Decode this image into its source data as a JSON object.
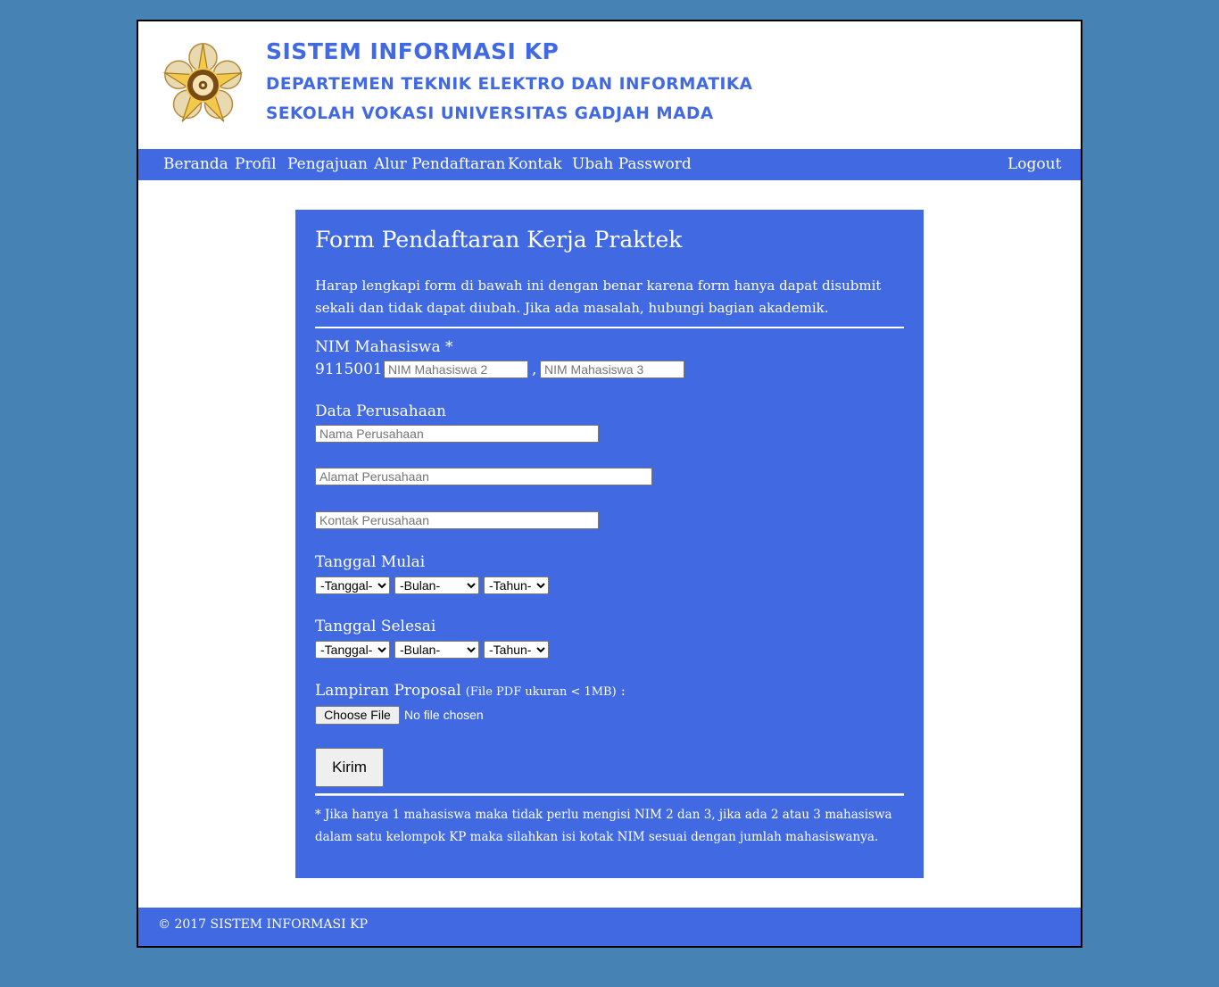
{
  "header": {
    "title": "SISTEM INFORMASI KP",
    "line2": "DEPARTEMEN TEKNIK ELEKTRO DAN INFORMATIKA",
    "line3": "SEKOLAH VOKASI UNIVERSITAS GADJAH MADA",
    "logo_icon": "university-seal-icon"
  },
  "nav": {
    "items": [
      "Beranda",
      "Profil",
      "Pengajuan",
      "Alur Pendaftaran",
      "Kontak",
      "Ubah Password"
    ],
    "logout": "Logout"
  },
  "form": {
    "title": "Form Pendaftaran Kerja Praktek",
    "intro": "Harap lengkapi form di bawah ini dengan benar karena form hanya dapat disubmit sekali dan tidak dapat diubah. Jika ada masalah, hubungi bagian akademik.",
    "nim_label": "NIM Mahasiswa *",
    "nim1": "9115001 ,",
    "nim_sep": ",",
    "nim2_placeholder": "NIM Mahasiswa 2",
    "nim3_placeholder": "NIM Mahasiswa 3",
    "company_label": "Data Perusahaan",
    "company_name_placeholder": "Nama Perusahaan",
    "company_address_placeholder": "Alamat Perusahaan",
    "company_contact_placeholder": "Kontak Perusahaan",
    "start_label": "Tanggal Mulai",
    "end_label": "Tanggal Selesai",
    "day_select": "-Tanggal-",
    "month_select": "-Bulan-",
    "year_select": "-Tahun-",
    "attachment_label": "Lampiran Proposal",
    "attachment_hint": "(File PDF ukuran < 1MB)",
    "attachment_colon": ":",
    "file_button": "Choose File",
    "file_status": "No file chosen",
    "submit": "Kirim",
    "note": "* Jika hanya 1 mahasiswa maka tidak perlu mengisi NIM 2 dan 3, jika ada 2 atau 3 mahasiswa dalam satu kelompok KP maka silahkan isi kotak NIM sesuai dengan jumlah mahasiswanya."
  },
  "footer": {
    "copyright": "© 2017 SISTEM INFORMASI KP"
  },
  "colors": {
    "background": "#4682b4",
    "accent": "#4169e1",
    "page": "#ffffff"
  }
}
